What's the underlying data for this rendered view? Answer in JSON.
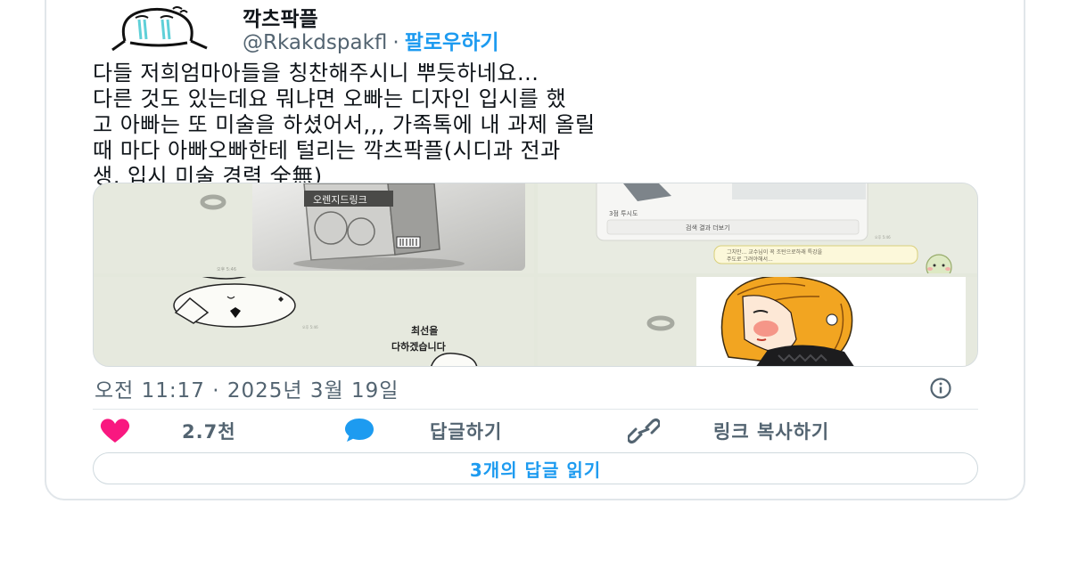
{
  "author": {
    "display_name": "깍츠팍플",
    "handle": "@Rkakdspakfl",
    "separator": "·",
    "follow_label": "팔로우하기"
  },
  "tweet": {
    "lines": [
      "다들 저희엄마아들을 칭찬해주시니 뿌듯하네요...",
      "다른 것도 있는데요 뭐냐면 오빠는 디자인 입시를 했",
      "고 아빠는 또 미술을 하셨어서,,, 가족톡에 내 과제 올릴",
      "때 마다 아빠오빠한테 털리는 깍츠팍플(시디과 전과",
      "생, 입시 미술 경력 全無)"
    ],
    "timestamp": "오전 11:17 · 2025년 3월 19일"
  },
  "media": {
    "chat_small_text": [
      "3점 투시도",
      "검색 결과 더보기",
      "그치만... 교수님이 꼭 조턴으로하래 특강을",
      "주도로 그려야해서..."
    ],
    "drawing_caption": [
      "최선을",
      "다하겠습니다"
    ],
    "carton_label": "오렌지드링크"
  },
  "actions": {
    "like_count": "2.7천",
    "reply_label": "답글하기",
    "copy_link_label": "링크 복사하기",
    "read_replies_label": "3개의 답글 읽기"
  },
  "icons": {
    "like": "heart-icon",
    "reply": "speech-bubble-icon",
    "copy": "link-icon",
    "info": "info-icon"
  },
  "colors": {
    "accent": "#1d9bf0",
    "like": "#f91880",
    "secondary_text": "#536471"
  }
}
